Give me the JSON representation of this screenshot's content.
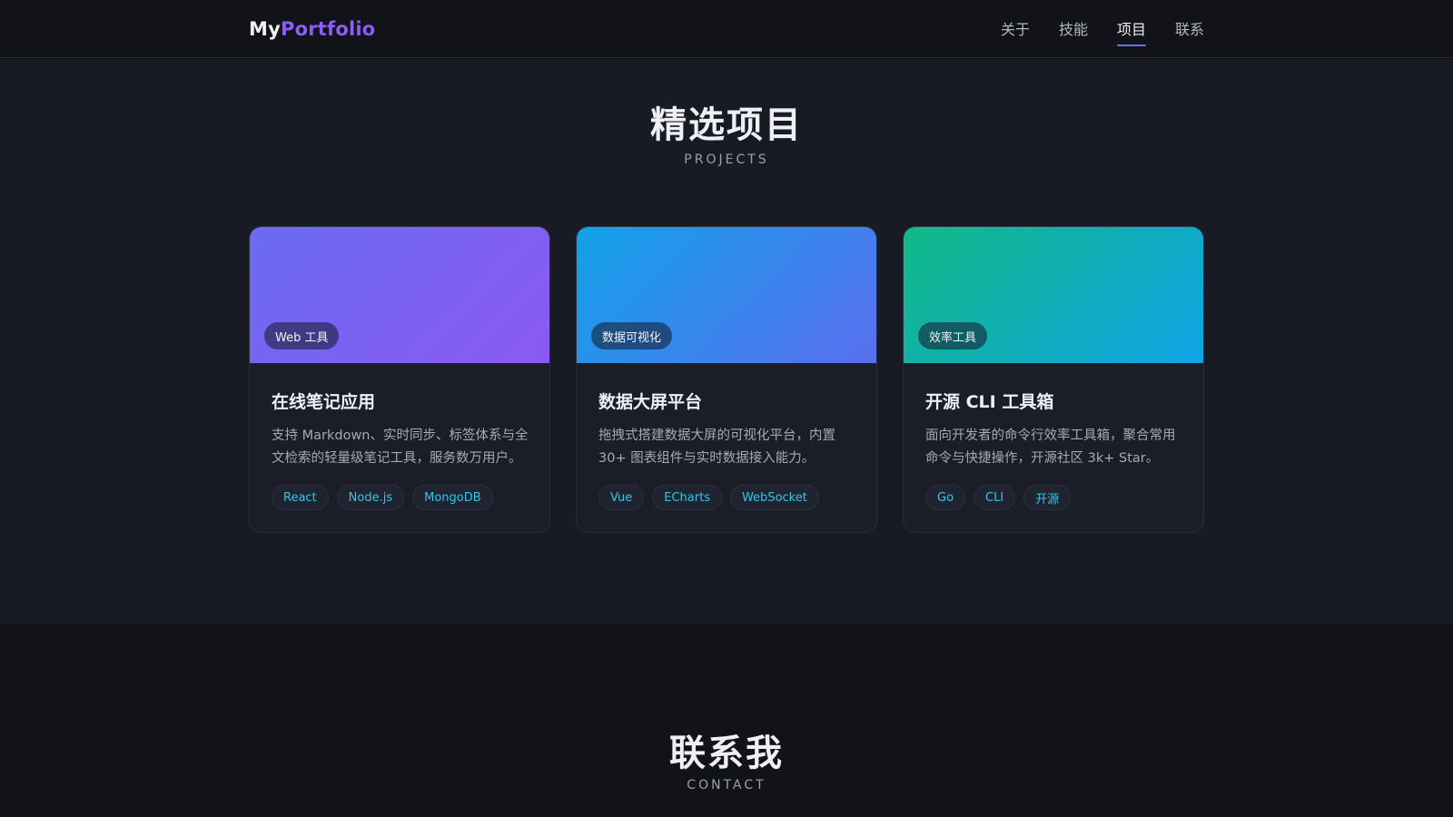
{
  "nav": {
    "logo_part1": "My",
    "logo_part2": "Portfolio",
    "links": [
      "关于",
      "技能",
      "项目",
      "联系"
    ],
    "active_link": "项目"
  },
  "projects_section": {
    "title": "精选项目",
    "subtitle": "PROJECTS",
    "cards": [
      {
        "badge": "Web 工具",
        "title": "在线笔记应用",
        "description": "支持 Markdown、实时同步、标签体系与全文检索的轻量级笔记工具，服务数万用户。",
        "tags": [
          "React",
          "Node.js",
          "MongoDB"
        ]
      },
      {
        "badge": "数据可视化",
        "title": "数据大屏平台",
        "description": "拖拽式搭建数据大屏的可视化平台，内置 30+ 图表组件与实时数据接入能力。",
        "tags": [
          "Vue",
          "ECharts",
          "WebSocket"
        ]
      },
      {
        "badge": "效率工具",
        "title": "开源 CLI 工具箱",
        "description": "面向开发者的命令行效率工具箱，聚合常用命令与快捷操作，开源社区 3k+ Star。",
        "tags": [
          "Go",
          "CLI",
          "开源"
        ]
      }
    ]
  },
  "contact_section": {
    "title": "联系我",
    "subtitle": "CONTACT"
  },
  "colors": {
    "accent_purple": "#8b5cf6",
    "tag_text": "#35c5e6"
  }
}
